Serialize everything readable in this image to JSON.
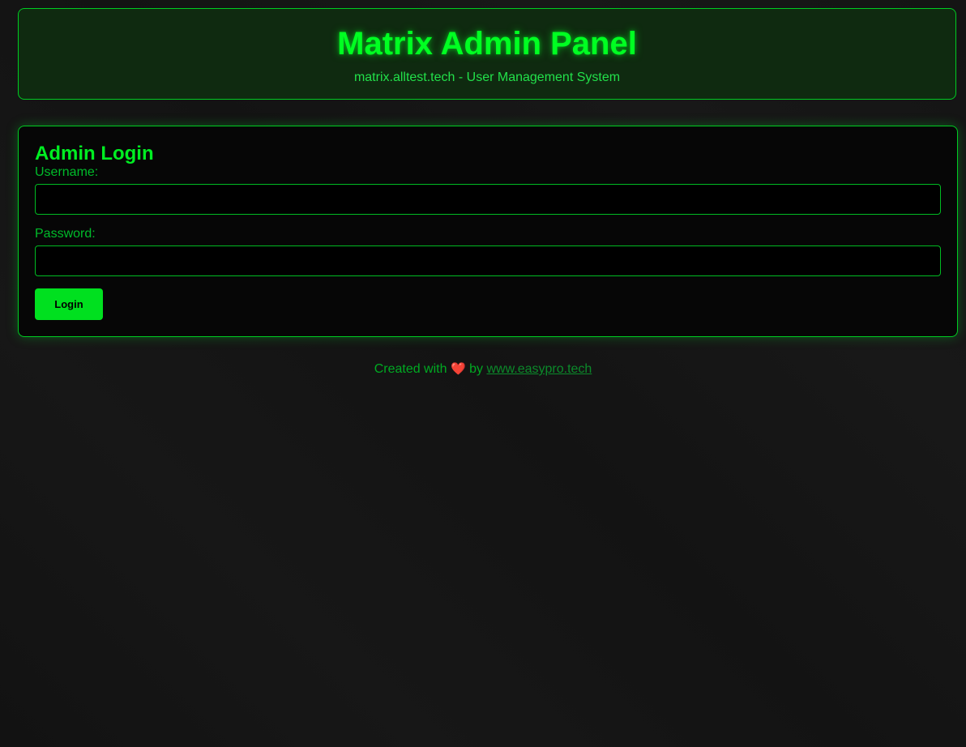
{
  "header": {
    "title": "Matrix Admin Panel",
    "subtitle": "matrix.alltest.tech - User Management System"
  },
  "login": {
    "title": "Admin Login",
    "username_label": "Username:",
    "username_value": "",
    "password_label": "Password:",
    "password_value": "",
    "button_label": "Login"
  },
  "footer": {
    "prefix": "Created with",
    "heart_icon": "heart-icon",
    "by": "by",
    "link_text": "www.easypro.tech"
  },
  "colors": {
    "accent": "#00ff22",
    "background": "#141414",
    "button": "#00e01f"
  }
}
